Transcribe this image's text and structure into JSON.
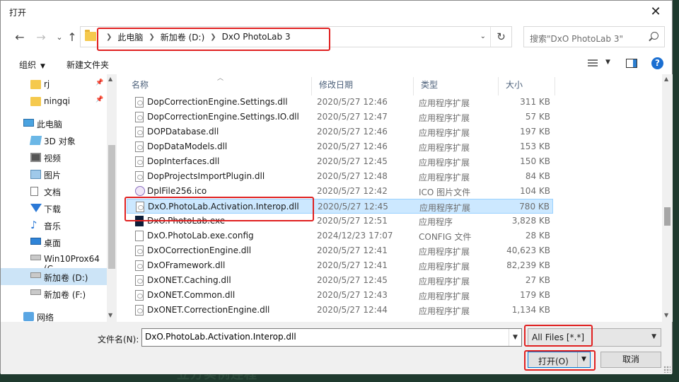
{
  "window": {
    "title": "打开",
    "close_glyph": "✕"
  },
  "nav_buttons": {
    "back": "←",
    "forward": "→",
    "up": "↑"
  },
  "address": {
    "crumbs": [
      "此电脑",
      "新加卷 (D:)",
      "DxO PhotoLab 3"
    ],
    "refresh_glyph": "↻"
  },
  "search": {
    "placeholder": "搜索\"DxO PhotoLab 3\""
  },
  "toolbar": {
    "organize": "组织",
    "new_folder": "新建文件夹",
    "help": "?"
  },
  "nav_pane": {
    "items": [
      {
        "label": "rj",
        "icon": "folder-icon",
        "pinned": true
      },
      {
        "label": "ningqi",
        "icon": "folder-icon",
        "pinned": true
      },
      {
        "label": "此电脑",
        "icon": "pc-icon"
      },
      {
        "label": "3D 对象",
        "icon": "objects-3d-icon"
      },
      {
        "label": "视频",
        "icon": "video-icon"
      },
      {
        "label": "图片",
        "icon": "pictures-icon"
      },
      {
        "label": "文档",
        "icon": "documents-icon"
      },
      {
        "label": "下载",
        "icon": "download-icon"
      },
      {
        "label": "音乐",
        "icon": "music-icon"
      },
      {
        "label": "桌面",
        "icon": "desktop-icon"
      },
      {
        "label": "Win10Prox64 (C",
        "icon": "drive-icon"
      },
      {
        "label": "新加卷 (D:)",
        "icon": "drive-icon",
        "selected": true
      },
      {
        "label": "新加卷 (F:)",
        "icon": "drive-icon"
      },
      {
        "label": "网络",
        "icon": "network-icon"
      }
    ]
  },
  "columns": {
    "name": "名称",
    "date": "修改日期",
    "type": "类型",
    "size": "大小"
  },
  "files": [
    {
      "name": "DopCorrectionEngine.Settings.dll",
      "date": "2020/5/27 12:46",
      "type": "应用程序扩展",
      "size": "311 KB",
      "icon": "dll-file-icon"
    },
    {
      "name": "DopCorrectionEngine.Settings.IO.dll",
      "date": "2020/5/27 12:47",
      "type": "应用程序扩展",
      "size": "57 KB",
      "icon": "dll-file-icon"
    },
    {
      "name": "DOPDatabase.dll",
      "date": "2020/5/27 12:46",
      "type": "应用程序扩展",
      "size": "197 KB",
      "icon": "dll-file-icon"
    },
    {
      "name": "DopDataModels.dll",
      "date": "2020/5/27 12:46",
      "type": "应用程序扩展",
      "size": "153 KB",
      "icon": "dll-file-icon"
    },
    {
      "name": "DopInterfaces.dll",
      "date": "2020/5/27 12:45",
      "type": "应用程序扩展",
      "size": "150 KB",
      "icon": "dll-file-icon"
    },
    {
      "name": "DopProjectsImportPlugin.dll",
      "date": "2020/5/27 12:48",
      "type": "应用程序扩展",
      "size": "84 KB",
      "icon": "dll-file-icon"
    },
    {
      "name": "DplFile256.ico",
      "date": "2020/5/27 12:42",
      "type": "ICO 图片文件",
      "size": "104 KB",
      "icon": "ico-file-icon"
    },
    {
      "name": "DxO.PhotoLab.Activation.Interop.dll",
      "date": "2020/5/27 12:45",
      "type": "应用程序扩展",
      "size": "780 KB",
      "icon": "dll-file-icon",
      "selected": true
    },
    {
      "name": "DxO.PhotoLab.exe",
      "date": "2020/5/27 12:51",
      "type": "应用程序",
      "size": "3,828 KB",
      "icon": "exe-file-icon"
    },
    {
      "name": "DxO.PhotoLab.exe.config",
      "date": "2024/12/23 17:07",
      "type": "CONFIG 文件",
      "size": "28 KB",
      "icon": "config-file-icon"
    },
    {
      "name": "DxOCorrectionEngine.dll",
      "date": "2020/5/27 12:41",
      "type": "应用程序扩展",
      "size": "40,623 KB",
      "icon": "dll-file-icon"
    },
    {
      "name": "DxOFramework.dll",
      "date": "2020/5/27 12:41",
      "type": "应用程序扩展",
      "size": "82,239 KB",
      "icon": "dll-file-icon"
    },
    {
      "name": "DxONET.Caching.dll",
      "date": "2020/5/27 12:45",
      "type": "应用程序扩展",
      "size": "27 KB",
      "icon": "dll-file-icon"
    },
    {
      "name": "DxONET.Common.dll",
      "date": "2020/5/27 12:43",
      "type": "应用程序扩展",
      "size": "179 KB",
      "icon": "dll-file-icon"
    },
    {
      "name": "DxONET.CorrectionEngine.dll",
      "date": "2020/5/27 12:44",
      "type": "应用程序扩展",
      "size": "1,134 KB",
      "icon": "dll-file-icon"
    }
  ],
  "bottom": {
    "filename_label": "文件名(N):",
    "filename_value": "DxO.PhotoLab.Activation.Interop.dll",
    "filter_value": "All Files [*.*]",
    "open_label": "打开(O)",
    "cancel_label": "取消"
  },
  "colors": {
    "highlight": "#e02020",
    "selection": "#cce8ff",
    "accent": "#0078d7"
  }
}
